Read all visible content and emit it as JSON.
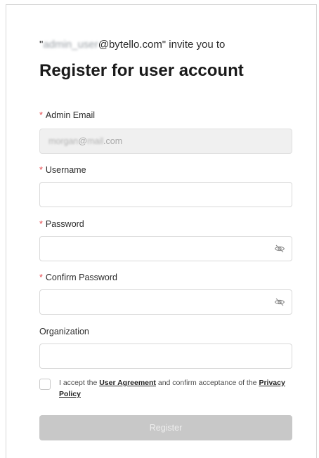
{
  "invite": {
    "quote_open": "\"",
    "masked_user": "admin_user",
    "domain": "@bytello.com\"",
    "suffix": " invite you to"
  },
  "title": "Register for user account",
  "required_mark": "*",
  "fields": {
    "admin_email": {
      "label": "Admin Email",
      "masked_local": "morgan",
      "at": "@",
      "masked_domain": "mail",
      "tld": ".com"
    },
    "username": {
      "label": "Username",
      "value": ""
    },
    "password": {
      "label": "Password",
      "value": ""
    },
    "confirm_password": {
      "label": "Confirm Password",
      "value": ""
    },
    "organization": {
      "label": "Organization",
      "value": ""
    }
  },
  "agreement": {
    "text_before": "I accept the ",
    "user_agreement_link": "User Agreement",
    "text_middle": " and confirm acceptance of the ",
    "privacy_policy_link": "Privacy Policy",
    "checked": false
  },
  "register_button": "Register",
  "icons": {
    "password_toggle": "eye-off-icon",
    "confirm_toggle": "eye-off-icon"
  },
  "colors": {
    "required": "#e5484d",
    "button_disabled_bg": "#c8c8c8",
    "disabled_input_bg": "#f0f0f0"
  }
}
